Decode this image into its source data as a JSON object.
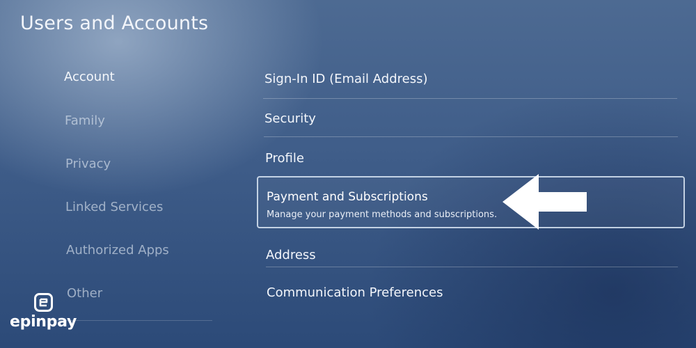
{
  "header": {
    "title": "Users and Accounts"
  },
  "sidebar": {
    "items": [
      {
        "label": "Account",
        "active": true
      },
      {
        "label": "Family",
        "active": false
      },
      {
        "label": "Privacy",
        "active": false
      },
      {
        "label": "Linked Services",
        "active": false
      },
      {
        "label": "Authorized Apps",
        "active": false
      },
      {
        "label": "Other",
        "active": false
      }
    ]
  },
  "main": {
    "items": [
      {
        "label": "Sign-In ID (Email Address)"
      },
      {
        "label": "Security"
      },
      {
        "label": "Profile"
      },
      {
        "label": "Payment and Subscriptions",
        "description": "Manage your payment methods and subscriptions.",
        "selected": true
      },
      {
        "label": "Address"
      },
      {
        "label": "Communication Preferences"
      }
    ]
  },
  "overlay": {
    "arrow_icon": "left-arrow-icon",
    "arrow_color": "#ffffff"
  },
  "watermark": {
    "logo_text": "epinpay",
    "icon": "epinpay-logo-icon"
  },
  "colors": {
    "background_top": "#4d6a92",
    "background_bottom": "#2c4a78",
    "text": "#ffffff",
    "selection_border": "#dce8f5"
  }
}
